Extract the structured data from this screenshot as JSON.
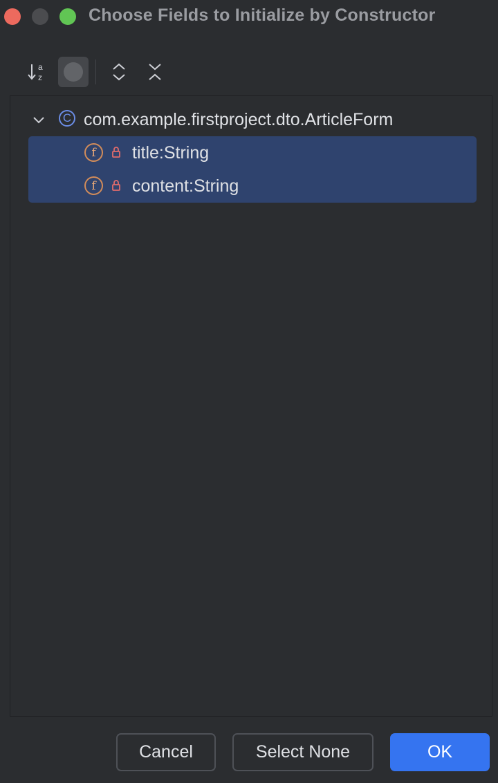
{
  "window": {
    "title": "Choose Fields to Initialize by Constructor"
  },
  "toolbar": {
    "sort_icon": "sort-alphabetically-icon",
    "toggle_icon": "toggle-icon",
    "expand_icon": "expand-all-icon",
    "collapse_icon": "collapse-all-icon"
  },
  "tree": {
    "class": {
      "icon_letter": "C",
      "label": "com.example.firstproject.dto.ArticleForm"
    },
    "fields": [
      {
        "icon_letter": "f",
        "label": "title:String",
        "selected": true
      },
      {
        "icon_letter": "f",
        "label": "content:String",
        "selected": true
      }
    ]
  },
  "buttons": {
    "cancel": "Cancel",
    "select_none": "Select None",
    "ok": "OK"
  },
  "colors": {
    "background": "#2b2d30",
    "selection": "#2f436e",
    "accent": "#3574f0",
    "class_icon": "#6b8de6",
    "field_icon": "#d28c5a",
    "lock": "#e06c6c"
  }
}
